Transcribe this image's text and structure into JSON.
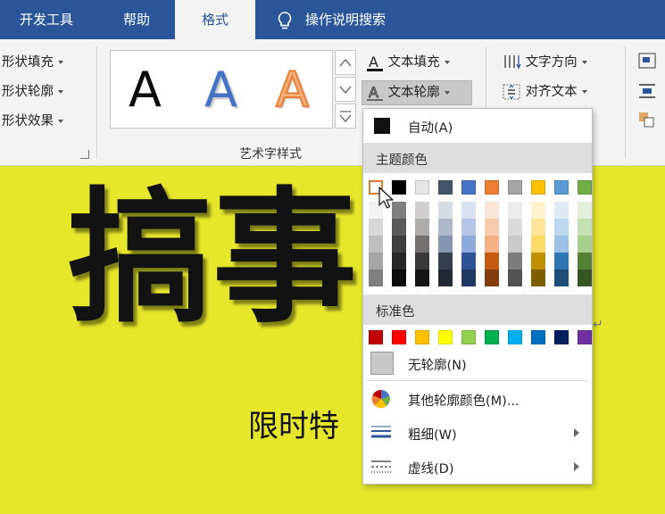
{
  "tabs": [
    {
      "label": "开发工具",
      "active": false
    },
    {
      "label": "帮助",
      "active": false
    },
    {
      "label": "格式",
      "active": true
    },
    {
      "label": "操作说明搜索",
      "active": false
    }
  ],
  "ribbon": {
    "shape_fill": "形状填充",
    "shape_outline": "形状轮廓",
    "shape_effects": "形状效果",
    "wordart_styles": [
      "A",
      "A",
      "A"
    ],
    "text_fill": "文本填充",
    "text_outline": "文本轮廓",
    "wordart_group": "艺术字样式",
    "text_direction": "文字方向",
    "align_text": "对齐文本"
  },
  "document": {
    "big_text": "搞事",
    "sub_text": "限时特",
    "paragraph_mark": "↵"
  },
  "dropdown": {
    "auto": "自动(A)",
    "theme_colors": "主题颜色",
    "theme_base": [
      "#ffffff",
      "#000000",
      "#e7e6e6",
      "#44546a",
      "#4472c4",
      "#ed7d31",
      "#a5a5a5",
      "#ffc000",
      "#5b9bd5",
      "#70ad47"
    ],
    "theme_shades": [
      [
        "#f2f2f2",
        "#d8d8d8",
        "#bfbfbf",
        "#a5a5a5",
        "#7f7f7f"
      ],
      [
        "#7f7f7f",
        "#595959",
        "#3f3f3f",
        "#262626",
        "#0c0c0c"
      ],
      [
        "#d0cece",
        "#aeabab",
        "#757171",
        "#3a3838",
        "#171616"
      ],
      [
        "#d6dce4",
        "#adb9ca",
        "#8496b0",
        "#333f4f",
        "#222a35"
      ],
      [
        "#d9e2f3",
        "#b4c6e7",
        "#8eaadb",
        "#2f5496",
        "#1f3864"
      ],
      [
        "#fbe5d5",
        "#f7cbac",
        "#f4b183",
        "#c55a11",
        "#833c0b"
      ],
      [
        "#ededed",
        "#dbdbdb",
        "#c9c9c9",
        "#7b7b7b",
        "#525252"
      ],
      [
        "#fff2cc",
        "#fee599",
        "#ffd965",
        "#bf9000",
        "#7f6000"
      ],
      [
        "#deebf6",
        "#bdd7ee",
        "#9cc2e5",
        "#2e75b5",
        "#1f4e79"
      ],
      [
        "#e2efd9",
        "#c5e0b3",
        "#a8d08d",
        "#538135",
        "#375623"
      ]
    ],
    "standard_colors": "标准色",
    "standard": [
      "#c00000",
      "#ff0000",
      "#ffc000",
      "#ffff00",
      "#92d050",
      "#00b050",
      "#00b0f0",
      "#0070c0",
      "#002060",
      "#7030a0"
    ],
    "no_outline": "无轮廓(N)",
    "more_colors": "其他轮廓颜色(M)...",
    "weight": "粗细(W)",
    "dashes": "虚线(D)"
  },
  "colors": {
    "tabbar": "#2b579a",
    "ribbon": "#f3f3f3",
    "document_bg": "#e6e62a"
  }
}
